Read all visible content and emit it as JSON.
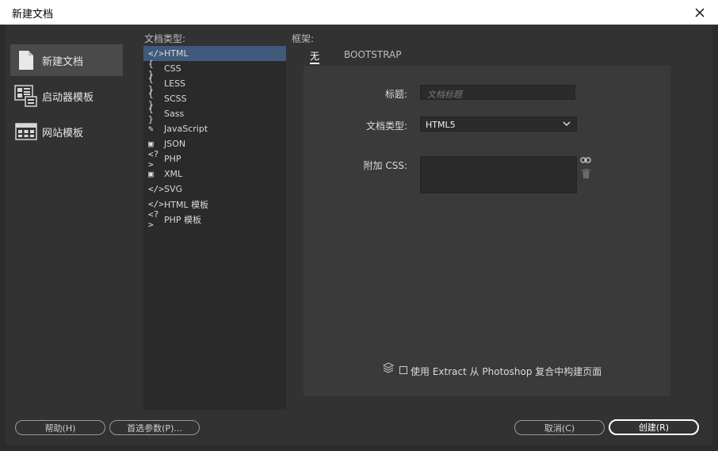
{
  "window": {
    "title": "新建文档"
  },
  "categories": [
    {
      "label": "新建文档",
      "icon": "document-icon"
    },
    {
      "label": "启动器模板",
      "icon": "starter-templates-icon"
    },
    {
      "label": "网站模板",
      "icon": "site-templates-icon"
    }
  ],
  "doc_types_header": "文档类型:",
  "doc_types": [
    {
      "label": "HTML",
      "glyph": "</>",
      "icon": "code-icon"
    },
    {
      "label": "CSS",
      "glyph": "{ }",
      "icon": "braces-icon"
    },
    {
      "label": "LESS",
      "glyph": "{ }",
      "icon": "braces-icon"
    },
    {
      "label": "SCSS",
      "glyph": "{ }",
      "icon": "braces-icon"
    },
    {
      "label": "Sass",
      "glyph": "{ }",
      "icon": "braces-icon"
    },
    {
      "label": "JavaScript",
      "glyph": "✎",
      "icon": "script-icon"
    },
    {
      "label": "JSON",
      "glyph": "▣",
      "icon": "json-icon"
    },
    {
      "label": "PHP",
      "glyph": "<?>",
      "icon": "php-icon"
    },
    {
      "label": "XML",
      "glyph": "▣",
      "icon": "xml-icon"
    },
    {
      "label": "SVG",
      "glyph": "</>",
      "icon": "code-icon"
    },
    {
      "label": "HTML 模板",
      "glyph": "</>",
      "icon": "code-icon"
    },
    {
      "label": "PHP 模板",
      "glyph": "<?>",
      "icon": "php-icon"
    }
  ],
  "framework_header": "框架:",
  "tabs": [
    {
      "label": "无"
    },
    {
      "label": "BOOTSTRAP"
    }
  ],
  "form": {
    "title_label": "标题:",
    "title_placeholder": "文档标题",
    "doctype_label": "文档类型:",
    "doctype_value": "HTML5",
    "css_label": "附加 CSS:"
  },
  "extract_label": "使用 Extract 从 Photoshop 复合中构建页面",
  "buttons": {
    "help": "帮助(H)",
    "prefs": "首选参数(P)...",
    "cancel": "取消(C)",
    "create": "创建(R)"
  }
}
